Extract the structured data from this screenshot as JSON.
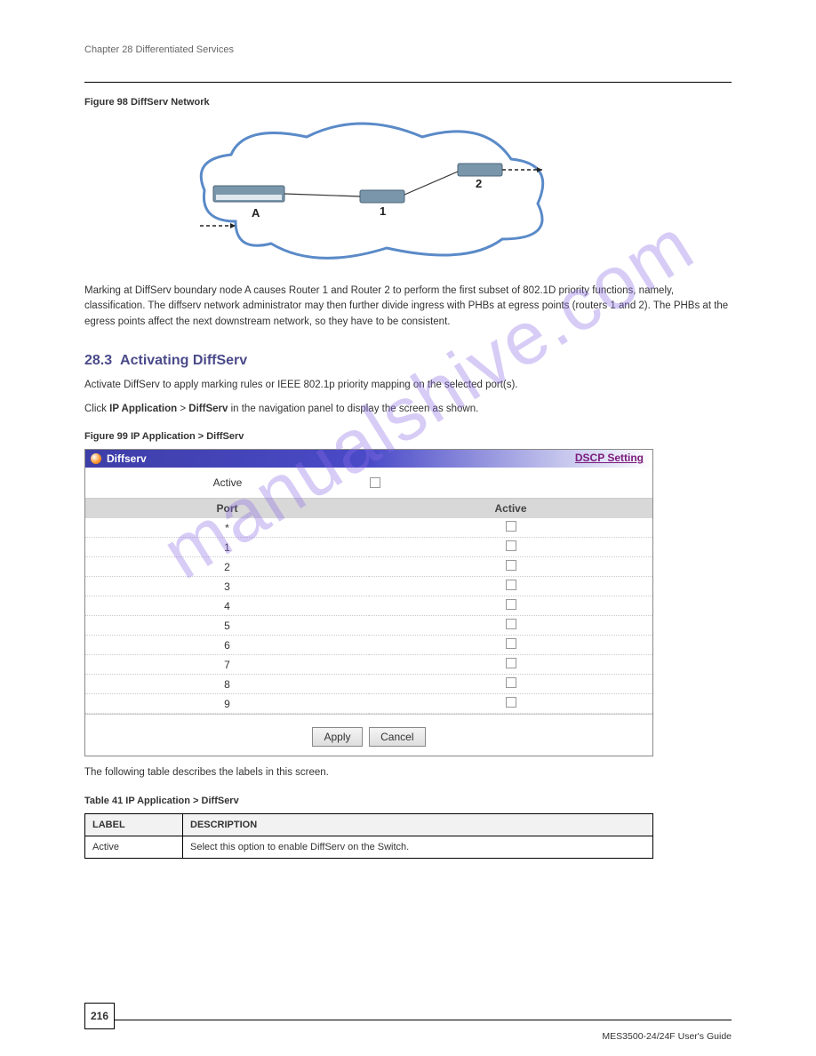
{
  "chapter": "Chapter 28 Differentiated Services",
  "fig98": {
    "caption": "Figure 98   DiffServ Network",
    "labels": {
      "A": "A",
      "one": "1",
      "two": "2"
    }
  },
  "paragraph": "Marking at DiffServ boundary node A causes Router 1 and Router 2 to perform the first subset of 802.1D priority functions, namely, classification. The diffserv network administrator may then further divide ingress with PHBs at egress points (routers 1 and 2). The PHBs at the egress points affect the next downstream network, so they have to be consistent.",
  "section": {
    "number": "28.3",
    "title": "Activating DiffServ"
  },
  "activating_text": "Activate DiffServ to apply marking rules or IEEE 802.1p priority mapping on the selected port(s).",
  "click_text_pre": "Click ",
  "click_text_bold1": "IP Application",
  "click_text_mid": " > ",
  "click_text_bold2": "DiffServ",
  "click_text_post": " in the navigation panel to display the screen as shown.",
  "fig99_caption": "Figure 99   IP Application > DiffServ",
  "screenshot": {
    "title": "Diffserv",
    "link": "DSCP Setting",
    "active_label": "Active",
    "columns": {
      "port": "Port",
      "active": "Active"
    },
    "rows": [
      {
        "port": "*"
      },
      {
        "port": "1"
      },
      {
        "port": "2"
      },
      {
        "port": "3"
      },
      {
        "port": "4"
      },
      {
        "port": "5"
      },
      {
        "port": "6"
      },
      {
        "port": "7"
      },
      {
        "port": "8"
      },
      {
        "port": "9"
      }
    ],
    "buttons": {
      "apply": "Apply",
      "cancel": "Cancel"
    }
  },
  "table_intro": "The following table describes the labels in this screen.",
  "table41": {
    "caption": "Table 41   IP Application > DiffServ",
    "headers": {
      "label": "LABEL",
      "description": "DESCRIPTION"
    },
    "rows": [
      {
        "label": "Active",
        "description": "Select this option to enable DiffServ on the Switch."
      }
    ]
  },
  "footer": {
    "page": "216",
    "guide": "MES3500-24/24F User's Guide"
  },
  "watermark": "manualshive.com"
}
